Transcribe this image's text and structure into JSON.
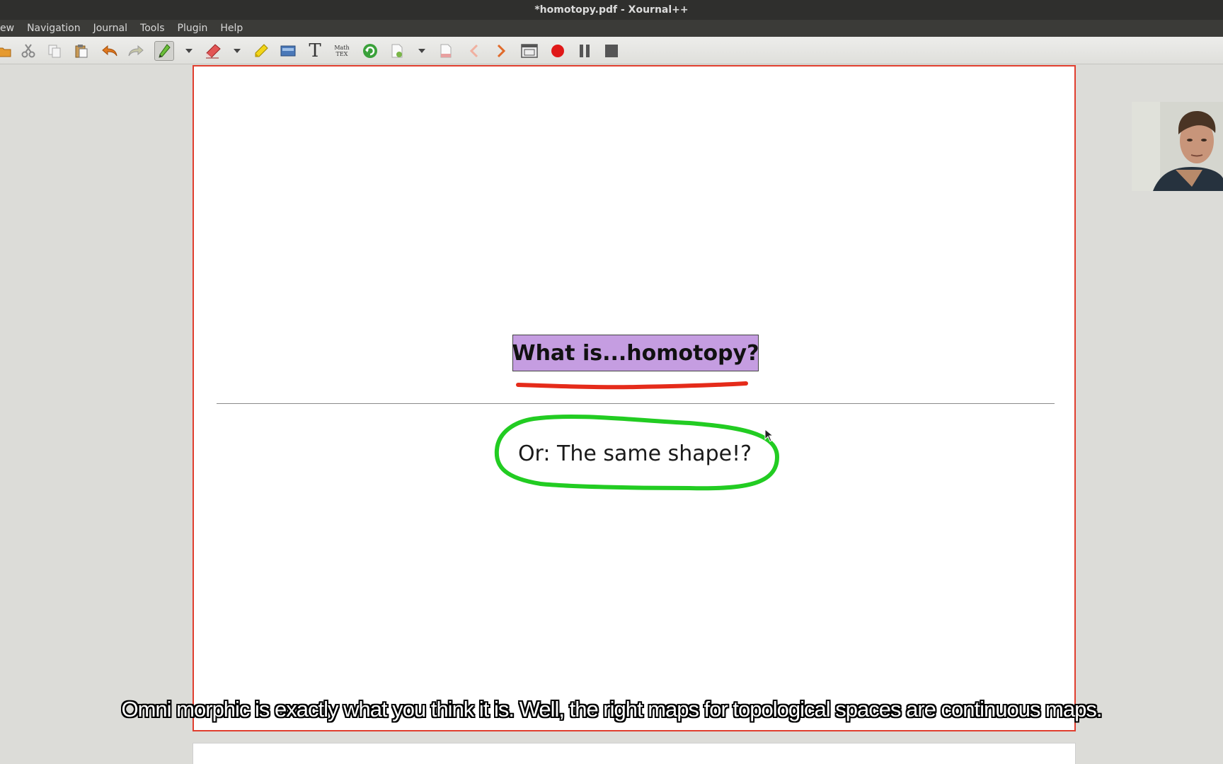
{
  "window": {
    "title": "*homotopy.pdf - Xournal++"
  },
  "menu": {
    "items": [
      "ew",
      "Navigation",
      "Journal",
      "Tools",
      "Plugin",
      "Help"
    ]
  },
  "toolbar": {
    "tools": [
      "open-icon",
      "cut-icon",
      "copy-icon",
      "paste-icon",
      "undo-icon",
      "redo-icon",
      "pen-icon",
      "dropdown-icon",
      "eraser-icon",
      "dropdown-icon",
      "highlighter-icon",
      "image-icon",
      "text-tool-icon",
      "latex-icon",
      "refresh-icon",
      "insert-page-icon",
      "dropdown-icon",
      "page-icon",
      "previous-page-icon",
      "next-page-icon",
      "fullscreen-icon",
      "record-icon",
      "pause-icon",
      "stop-icon"
    ],
    "text_tool_glyph": "T",
    "math_tool_line1": "Math",
    "math_tool_line2": "TEX",
    "active_tool": "pen"
  },
  "slide": {
    "title": "What is...homotopy?",
    "subtitle": "Or:  The same shape!?"
  },
  "annotations": {
    "underline_color": "#e52b1a",
    "loop_color": "#22cc22"
  },
  "page_border_color": "#e03e2e",
  "caption": {
    "text": "Omni morphic is exactly what you think it is. Well, the right maps for topological spaces are continuous maps."
  }
}
